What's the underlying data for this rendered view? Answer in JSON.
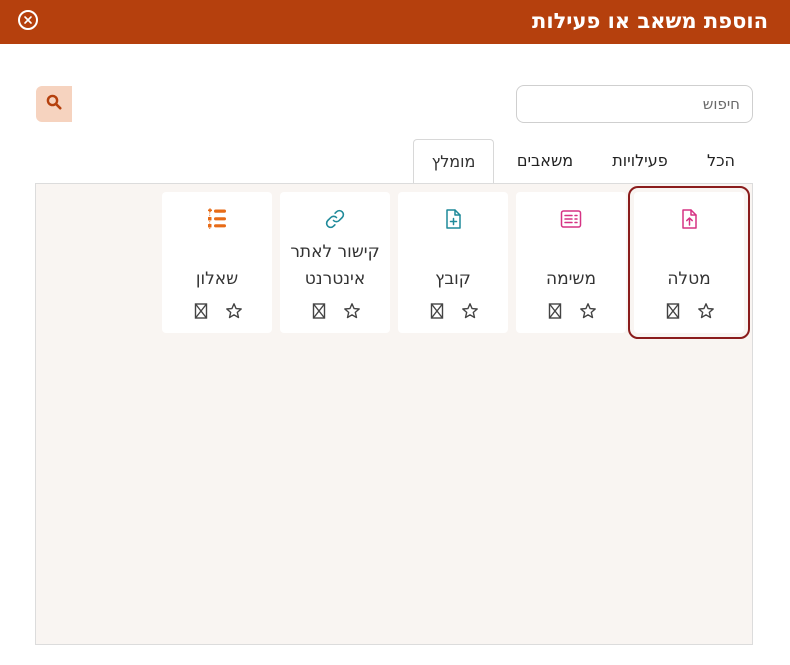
{
  "header": {
    "title": "הוספת משאב או פעילות"
  },
  "search": {
    "placeholder": "חיפוש"
  },
  "tabs": [
    {
      "label": "הכל"
    },
    {
      "label": "פעילויות"
    },
    {
      "label": "משאבים"
    },
    {
      "label": "מומלץ"
    }
  ],
  "active_tab": "מומלץ",
  "cards": [
    {
      "label": "מטלה",
      "icon": "file-upload-icon",
      "color": "#d63384"
    },
    {
      "label": "משימה",
      "icon": "task-list-icon",
      "color": "#d63384"
    },
    {
      "label": "קובץ",
      "icon": "file-plus-icon",
      "color": "#1f8a9a"
    },
    {
      "label_line1": "קישור לאתר",
      "label_line2": "אינטרנט",
      "icon": "link-icon",
      "color": "#1f8a9a"
    },
    {
      "label": "שאלון",
      "icon": "quiz-list-icon",
      "color": "#e76b17"
    }
  ],
  "colors": {
    "header": "#b5400d",
    "search_button": "#f6d3bf",
    "selected_outline": "#8a1c1c"
  }
}
